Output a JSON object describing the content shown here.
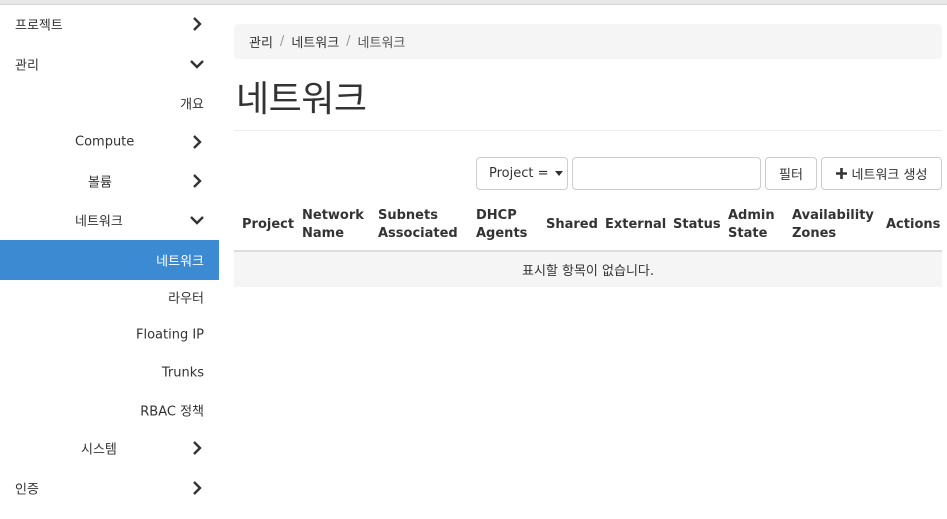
{
  "sidebar": {
    "items": [
      {
        "label": "프로젝트",
        "chevron": "right"
      },
      {
        "label": "관리",
        "chevron": "down"
      },
      {
        "label": "개요",
        "chevron": ""
      },
      {
        "label": "Compute",
        "chevron": "right"
      },
      {
        "label": "볼륨",
        "chevron": "right"
      },
      {
        "label": "네트워크",
        "chevron": "down"
      },
      {
        "label": "네트워크",
        "chevron": "",
        "active": true
      },
      {
        "label": "라우터",
        "chevron": ""
      },
      {
        "label": "Floating IP",
        "chevron": ""
      },
      {
        "label": "Trunks",
        "chevron": ""
      },
      {
        "label": "RBAC 정책",
        "chevron": ""
      },
      {
        "label": "시스템",
        "chevron": "right"
      },
      {
        "label": "인증",
        "chevron": "right"
      }
    ]
  },
  "breadcrumb": {
    "items": [
      "관리",
      "네트워크",
      "네트워크"
    ],
    "separator": "/"
  },
  "page": {
    "title": "네트워크"
  },
  "toolbar": {
    "filter_field": "Project =",
    "filter_input_value": "",
    "filter_button": "필터",
    "create_button": "네트워크 생성"
  },
  "table": {
    "columns": [
      "Project",
      "Network Name",
      "Subnets Associated",
      "DHCP Agents",
      "Shared",
      "External",
      "Status",
      "Admin State",
      "Availability Zones",
      "Actions"
    ],
    "empty_message": "표시할 항목이 없습니다."
  },
  "colors": {
    "active_nav": "#3c8ad1",
    "breadcrumb_bg": "#f5f5f5"
  },
  "icons": {
    "chevron_right": "chevron-right-icon",
    "chevron_down": "chevron-down-icon",
    "plus": "plus-icon",
    "caret": "caret-down-icon"
  }
}
